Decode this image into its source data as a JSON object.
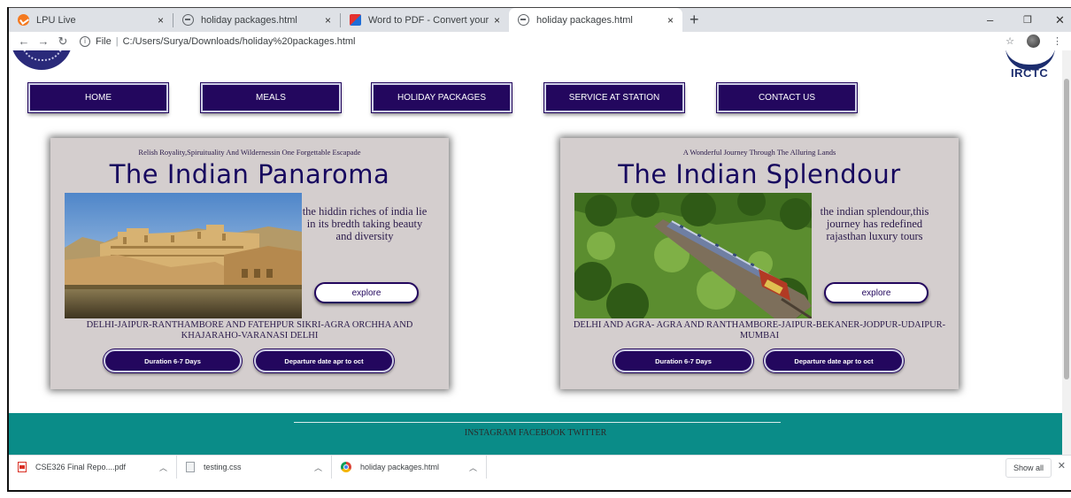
{
  "browser": {
    "tabs": [
      {
        "title": "LPU Live",
        "icon": "lpu-icon",
        "active": false
      },
      {
        "title": "holiday packages.html",
        "icon": "globe-icon",
        "active": false
      },
      {
        "title": "Word to PDF - Convert your DOC",
        "icon": "ilovepdf-icon",
        "active": false
      },
      {
        "title": "holiday packages.html",
        "icon": "globe-icon",
        "active": true
      }
    ],
    "new_tab": "+",
    "close_glyph": "×",
    "window_controls": {
      "minimize": "–",
      "maximize": "❐",
      "close": "✕"
    },
    "address": {
      "scheme": "File",
      "url": "C:/Users/Surya/Downloads/holiday%20packages.html"
    }
  },
  "page": {
    "logo_text": "IRCTC",
    "nav": [
      "HOME",
      "MEALS",
      "HOLIDAY PACKAGES",
      "SERVICE AT STATION",
      "CONTACT US"
    ],
    "packages": [
      {
        "tagline": "Relish Royality,Spiruituality And Wildernessin One Forgettable Escapade",
        "title": "The Indian Panaroma",
        "description": "the hiddin riches of india lie in its bredth taking beauty and diversity",
        "explore": "explore",
        "route": "DELHI-JAIPUR-RANTHAMBORE AND FATEHPUR SIKRI-AGRA ORCHHA AND KHAJARAHO-VARANASI DELHI",
        "duration": "Duration 6-7 Days",
        "departure": "Departure date apr to oct"
      },
      {
        "tagline": "A Wonderful Journey Through The Alluring Lands",
        "title": "The Indian Splendour",
        "description": "the indian splendour,this journey has redefined rajasthan luxury tours",
        "explore": "explore",
        "route": "DELHI AND AGRA- AGRA AND RANTHAMBORE-JAIPUR-BEKANER-JODPUR-UDAIPUR-MUMBAI",
        "duration": "Duration 6-7 Days",
        "departure": "Departure date apr to oct"
      }
    ],
    "footer": {
      "social": "INSTAGRAM FACEBOOK TWITTER"
    }
  },
  "downloads": {
    "items": [
      {
        "name": "CSE326 Final Repo....pdf",
        "icon": "pdf-file-icon"
      },
      {
        "name": "testing.css",
        "icon": "css-file-icon"
      },
      {
        "name": "holiday packages.html",
        "icon": "chrome-file-icon"
      }
    ],
    "show_all": "Show all",
    "close": "✕"
  },
  "colors": {
    "nav_bg": "#23075e",
    "card_bg": "#d4cece",
    "title": "#17095f",
    "footer": "#0a8c88"
  }
}
